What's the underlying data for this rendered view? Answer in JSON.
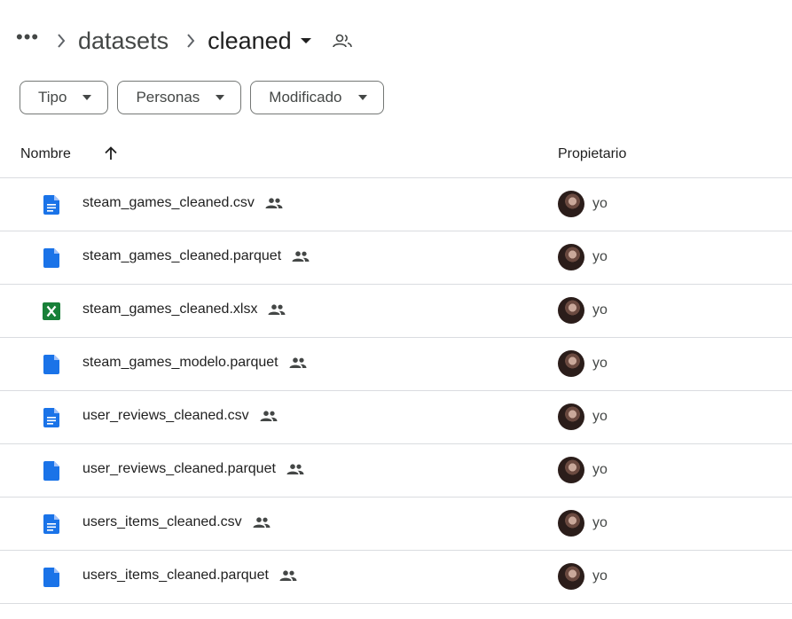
{
  "breadcrumb": {
    "more": "•••",
    "items": [
      "datasets",
      "cleaned"
    ]
  },
  "filters": [
    {
      "label": "Tipo"
    },
    {
      "label": "Personas"
    },
    {
      "label": "Modificado"
    }
  ],
  "table": {
    "col_name": "Nombre",
    "col_owner": "Propietario",
    "sort": "ascending",
    "rows": [
      {
        "name": "steam_games_cleaned.csv",
        "type": "doc",
        "owner": "yo"
      },
      {
        "name": "steam_games_cleaned.parquet",
        "type": "file",
        "owner": "yo"
      },
      {
        "name": "steam_games_cleaned.xlsx",
        "type": "sheet",
        "owner": "yo"
      },
      {
        "name": "steam_games_modelo.parquet",
        "type": "file",
        "owner": "yo"
      },
      {
        "name": "user_reviews_cleaned.csv",
        "type": "doc",
        "owner": "yo"
      },
      {
        "name": "user_reviews_cleaned.parquet",
        "type": "file",
        "owner": "yo"
      },
      {
        "name": "users_items_cleaned.csv",
        "type": "doc",
        "owner": "yo"
      },
      {
        "name": "users_items_cleaned.parquet",
        "type": "file",
        "owner": "yo"
      }
    ]
  },
  "colors": {
    "doc_blue": "#1a73e8",
    "sheet_green": "#188038",
    "divider": "#dadce0"
  },
  "icons": {
    "doc": "doc-file-icon",
    "file": "generic-file-icon",
    "sheet": "sheets-file-icon",
    "shared": "shared-people-icon"
  }
}
